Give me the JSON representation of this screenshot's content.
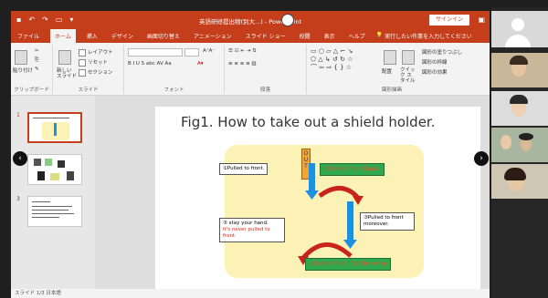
{
  "window": {
    "title": "英語研修提出物(別大...) - PowerPoint",
    "signin_label": "サインイン",
    "qa_icons": [
      "save-icon",
      "undo-icon",
      "redo-icon",
      "present-icon"
    ]
  },
  "tabs": [
    {
      "label": "ファイル",
      "active": false
    },
    {
      "label": "ホーム",
      "active": true
    },
    {
      "label": "挿入",
      "active": false
    },
    {
      "label": "デザイン",
      "active": false
    },
    {
      "label": "画面切り替え",
      "active": false
    },
    {
      "label": "アニメーション",
      "active": false
    },
    {
      "label": "スライド ショー",
      "active": false
    },
    {
      "label": "校閲",
      "active": false
    },
    {
      "label": "表示",
      "active": false
    },
    {
      "label": "ヘルプ",
      "active": false
    }
  ],
  "tell_me": "実行したい作業を入力してください",
  "ribbon": {
    "clipboard": {
      "paste": "貼り付け",
      "label": "クリップボード"
    },
    "slides": {
      "new_slide": "新しい スライド",
      "layout": "レイアウト",
      "reset": "リセット",
      "section": "セクション",
      "label": "スライド"
    },
    "font": {
      "label": "フォント",
      "format": "B  I  U  S  abc  AV  Aa"
    },
    "paragraph": {
      "label": "段落"
    },
    "drawing": {
      "arrange": "配置",
      "quick_styles": "クイック スタイル",
      "fill": "図形の塗りつぶし",
      "outline": "図形の枠線",
      "effects": "図形の効果",
      "label": "図形描画"
    }
  },
  "thumbnails": [
    {
      "num": "1",
      "active": true
    },
    {
      "num": "2",
      "active": false
    },
    {
      "num": "3",
      "active": false
    }
  ],
  "slide": {
    "title": "Fig1. How to take out a shield holder.",
    "out_label": "O U T",
    "step1": "①Pulled to front.",
    "step2": "②Turn  15°  clockwise",
    "step3": "③Pulled to front moreover.",
    "step4": "④Turn  45°  counterclockwise",
    "step5_line1": "⑤ stay your hand.",
    "step5_line2": "It's never pulled to front."
  },
  "status": "スライド 1/3   日本語",
  "colors": {
    "accent": "#c43e1c",
    "green": "#2fa84f",
    "blue_arrow": "#1f8fe0",
    "red_arrow": "#c9241a"
  }
}
